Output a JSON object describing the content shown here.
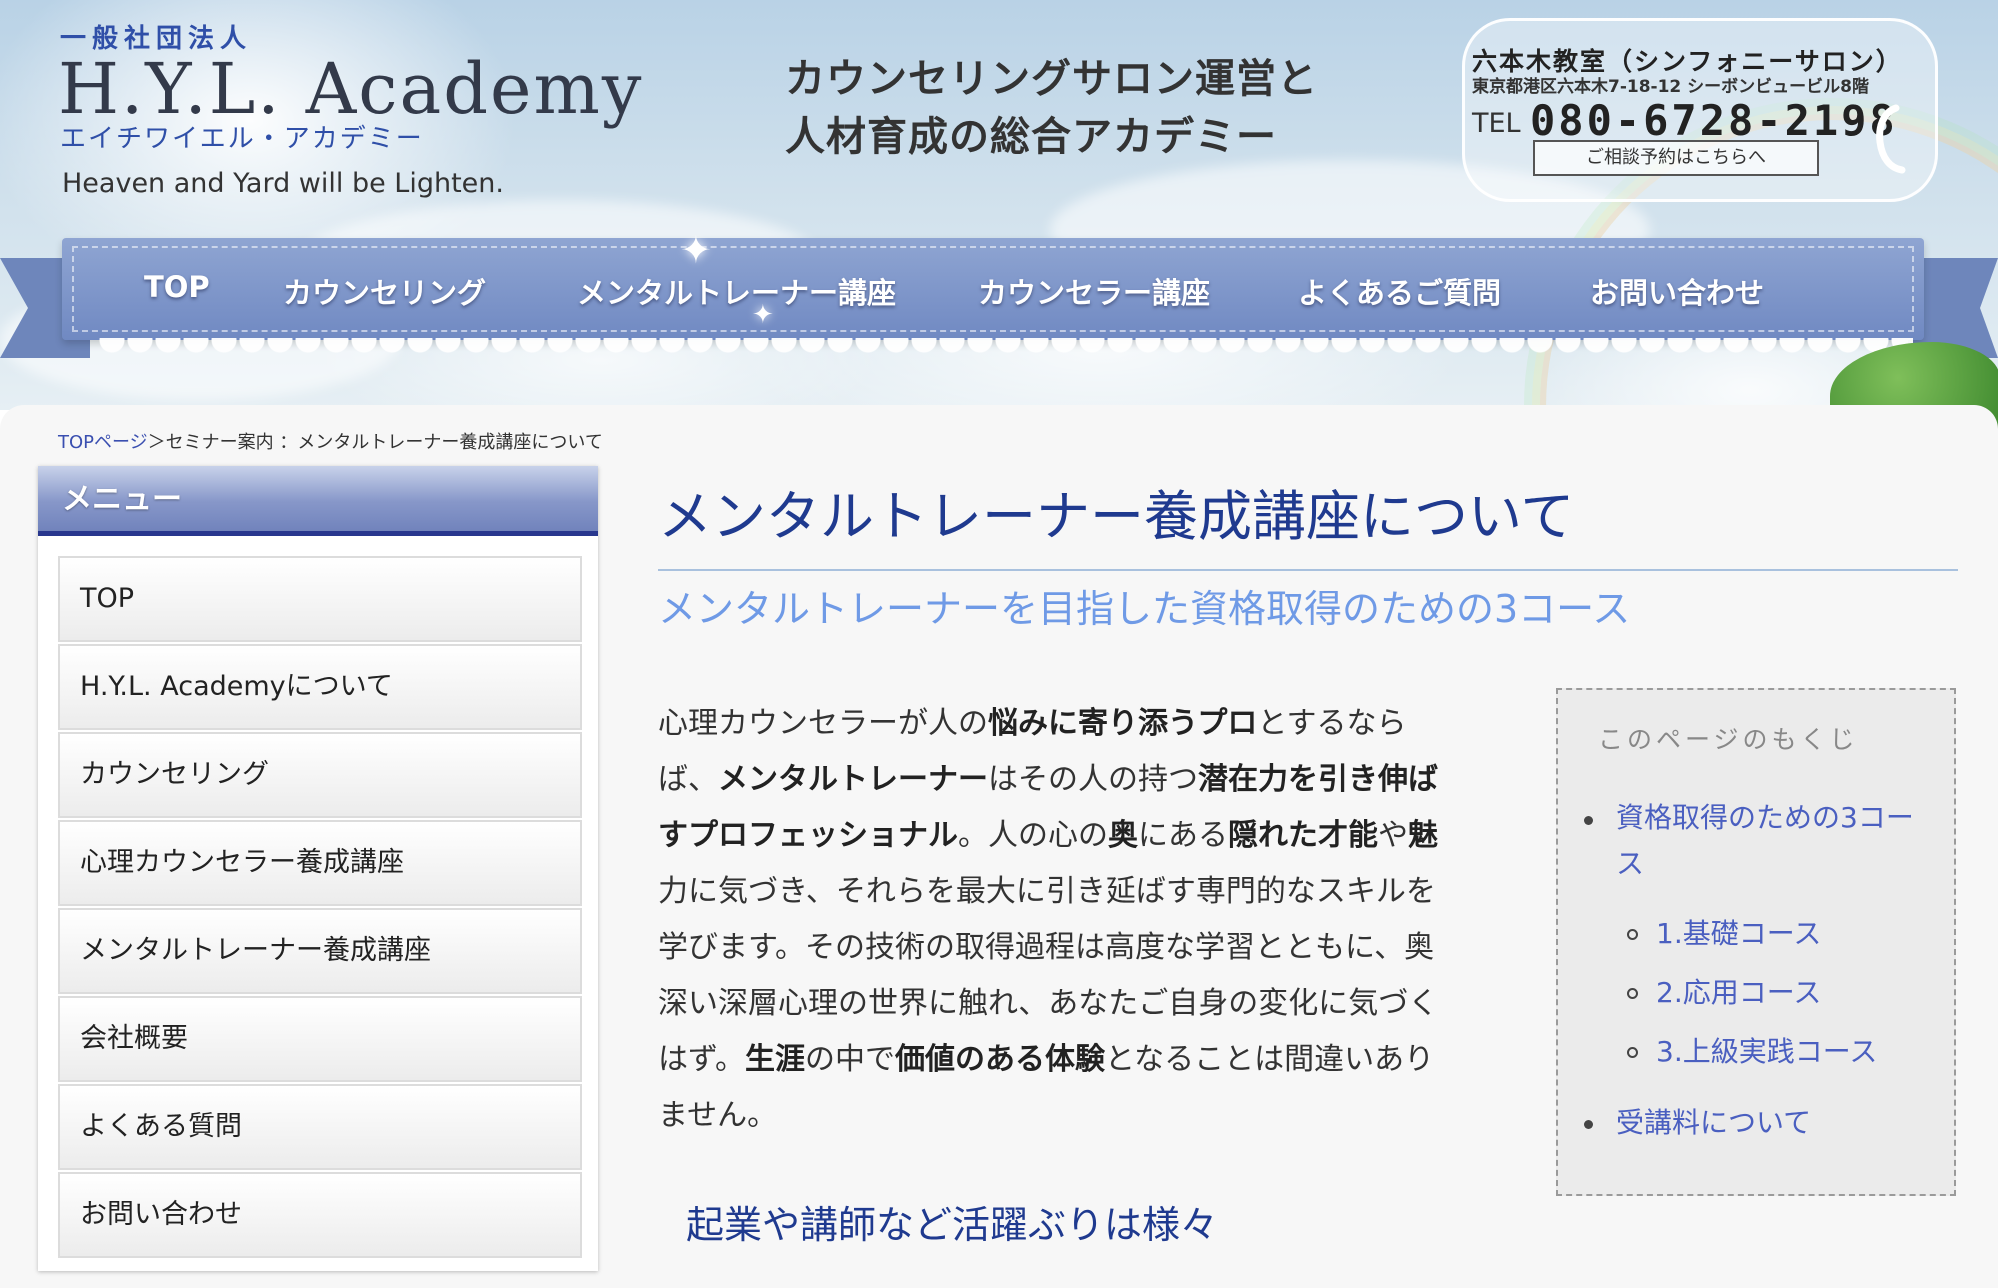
{
  "header": {
    "org_type": "一般社団法人",
    "logo_title": "H.Y.L. Academy",
    "logo_kana": "エイチワイエル・アカデミー",
    "tagline": "Heaven and Yard will be Lighten.",
    "catch_line1": "カウンセリングサロン運営と",
    "catch_line2": "人材育成の総合アカデミー",
    "contact": {
      "name": "六本木教室（シンフォニーサロン）",
      "address": "東京都港区六本木7-18-12 シーボンビュービル8階",
      "tel_label": "TEL",
      "tel": "080-6728-2198",
      "button": "ご相談予約はこちらへ"
    }
  },
  "nav": {
    "items": [
      "TOP",
      "カウンセリング",
      "メンタルトレーナー講座",
      "カウンセラー講座",
      "よくあるご質問",
      "お問い合わせ"
    ]
  },
  "breadcrumb": {
    "home": "TOPページ",
    "separator": "＞",
    "rest": "セミナー案内 ：メンタルトレーナー養成講座について"
  },
  "sidebar": {
    "title": "メニュー",
    "items": [
      "TOP",
      "H.Y.L. Academyについて",
      "カウンセリング",
      "心理カウンセラー養成講座",
      "メンタルトレーナー養成講座",
      "会社概要",
      "よくある質問",
      "お問い合わせ"
    ]
  },
  "main": {
    "title": "メンタルトレーナー養成講座について",
    "subtitle": "メンタルトレーナーを目指した資格取得のための3コース",
    "body_lines": [
      [
        "心理カウンセラーが人の",
        "悩みに寄り添うプロ",
        "とするなら"
      ],
      [
        "ば、",
        "メンタルトレーナー",
        "はその人の持つ",
        "潜在力を引き伸ば"
      ],
      [
        "すプロフェッショナル",
        "。人の心の",
        "奥",
        "にある",
        "隠れた才能",
        "や",
        "魅"
      ],
      [
        "力に気づき、それらを最大に引き延ばす専門的なスキルを"
      ],
      [
        "学びます。その技術の取得過程は高度な学習とともに、奥"
      ],
      [
        "深い深層心理の世界に触れ、あなたご自身の変化に気づく"
      ],
      [
        "はず。",
        "生涯",
        "の中で",
        "価値のある体験",
        "となることは間違いあり"
      ],
      [
        "ません。"
      ]
    ],
    "heading2": "起業や講師など活躍ぶりは様々"
  },
  "toc": {
    "title": "このページのもくじ",
    "item1_line1": "資格取得のための3コー",
    "item1_line2": "ス",
    "sub": [
      "1.基礎コース",
      "2.応用コース",
      "3.上級実践コース"
    ],
    "item2": "受講料について"
  },
  "colors": {
    "accent": "#1f3a8f",
    "subtitle": "#6f9ae6",
    "link": "#4a5fc0",
    "nav": "#7a91c6",
    "menu_border": "#28378e"
  }
}
